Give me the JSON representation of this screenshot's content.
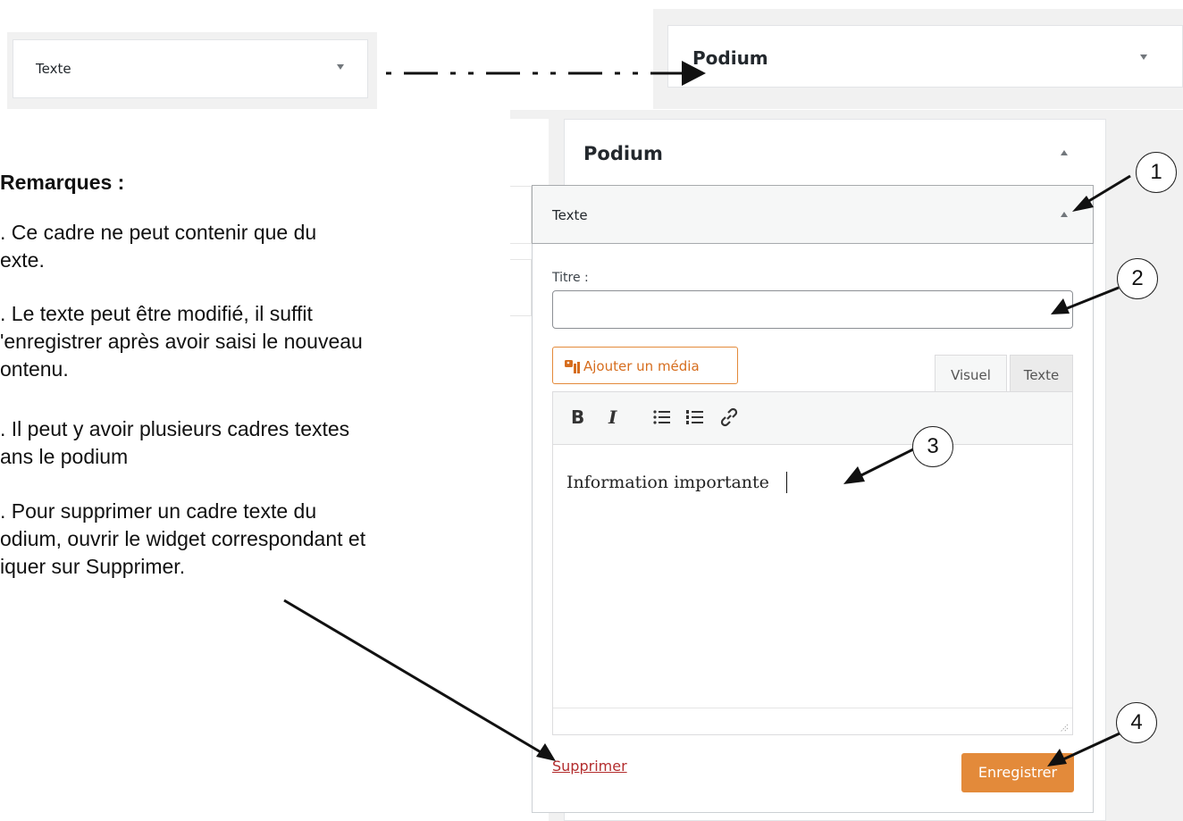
{
  "top_left_widget": {
    "title": "Texte"
  },
  "top_right_widget": {
    "title": "Podium"
  },
  "remarks": {
    "heading": "Remarques :",
    "lines": [
      ". Ce cadre ne peut contenir que du",
      "exte.",
      ". Le texte peut être modifié, il suffit",
      "'enregistrer après avoir saisi le nouveau",
      "ontenu.",
      ". Il peut y avoir plusieurs cadres textes",
      "ans le podium",
      ". Pour supprimer un cadre texte du",
      "odium, ouvrir le widget correspondant et",
      "iquer sur Supprimer."
    ]
  },
  "podium": {
    "title": "Podium"
  },
  "text_widget": {
    "title": "Texte",
    "titre_label": "Titre :",
    "titre_value": "",
    "add_media_label": "Ajouter un média",
    "tabs": [
      "Visuel",
      "Texte"
    ],
    "toolbar": {
      "bold": "B",
      "italic": "I",
      "bullet_list": "☰",
      "numbered_list": "☰",
      "link": "🔗"
    },
    "editor_content": "Information importante",
    "delete_label": "Supprimer",
    "save_label": "Enregistrer"
  },
  "callouts": [
    "1",
    "2",
    "3",
    "4"
  ]
}
